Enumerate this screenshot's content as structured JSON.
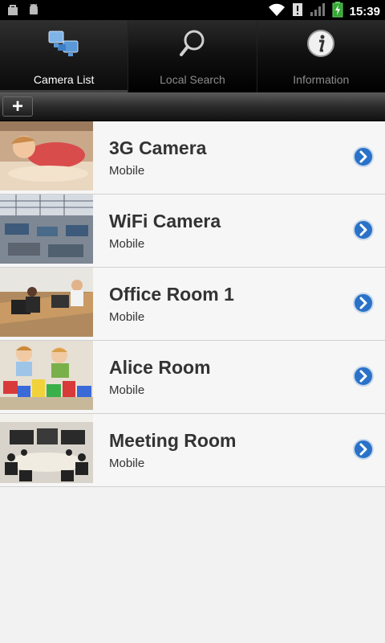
{
  "status_bar": {
    "time": "15:39",
    "icons": [
      "bag-icon",
      "android-icon",
      "wifi-icon",
      "alert-icon",
      "signal-icon",
      "battery-charging-icon"
    ]
  },
  "tabs": [
    {
      "label": "Camera List",
      "icon": "camera-list-icon",
      "active": true
    },
    {
      "label": "Local Search",
      "icon": "search-icon",
      "active": false
    },
    {
      "label": "Information",
      "icon": "info-icon",
      "active": false
    }
  ],
  "toolbar": {
    "add_label": "+"
  },
  "cameras": [
    {
      "name": "3G Camera",
      "type": "Mobile",
      "thumbnail": "sleeping-child-thumbnail"
    },
    {
      "name": "WiFi Camera",
      "type": "Mobile",
      "thumbnail": "factory-floor-thumbnail"
    },
    {
      "name": "Office Room 1",
      "type": "Mobile",
      "thumbnail": "office-thumbnail"
    },
    {
      "name": "Alice Room",
      "type": "Mobile",
      "thumbnail": "kids-playing-thumbnail"
    },
    {
      "name": "Meeting Room",
      "type": "Mobile",
      "thumbnail": "meeting-room-thumbnail"
    }
  ],
  "colors": {
    "accent_blue": "#2a72c8",
    "background": "#f2f2f2"
  }
}
